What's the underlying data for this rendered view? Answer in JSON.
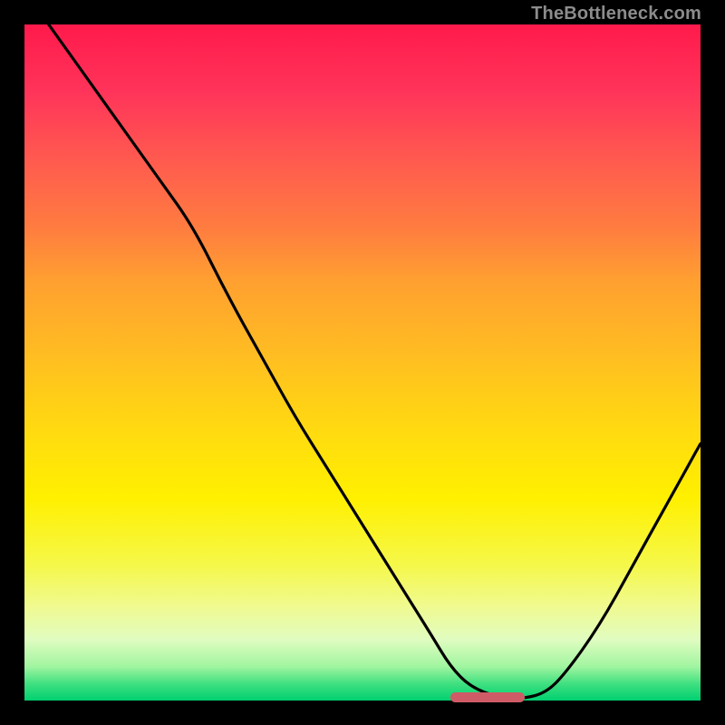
{
  "watermark": "TheBottleneck.com",
  "colors": {
    "background": "#000000",
    "marker": "#cf5b67",
    "curve": "#000000",
    "watermark_text": "#8c8c8c"
  },
  "chart_data": {
    "type": "line",
    "title": "",
    "xlabel": "",
    "ylabel": "",
    "xlim": [
      0,
      100
    ],
    "ylim": [
      0,
      100
    ],
    "x": [
      0,
      5,
      10,
      15,
      20,
      25,
      30,
      35,
      40,
      45,
      50,
      55,
      60,
      63,
      66,
      70,
      73,
      77,
      80,
      85,
      90,
      95,
      100
    ],
    "values": [
      105,
      98,
      91,
      84,
      77,
      70,
      60,
      51,
      42,
      34,
      26,
      18,
      10,
      5,
      2,
      0.5,
      0.2,
      1,
      4,
      11,
      20,
      29,
      38
    ],
    "optimum_range_x": [
      63,
      74
    ],
    "optimum_value_y": 0.5,
    "gradient_stops": [
      {
        "pos": 0,
        "color": "#ff1a4c"
      },
      {
        "pos": 0.1,
        "color": "#ff345a"
      },
      {
        "pos": 0.2,
        "color": "#ff5a4f"
      },
      {
        "pos": 0.3,
        "color": "#ff7c40"
      },
      {
        "pos": 0.38,
        "color": "#ffa030"
      },
      {
        "pos": 0.5,
        "color": "#ffc020"
      },
      {
        "pos": 0.6,
        "color": "#ffda10"
      },
      {
        "pos": 0.7,
        "color": "#fff000"
      },
      {
        "pos": 0.8,
        "color": "#f5f84a"
      },
      {
        "pos": 0.86,
        "color": "#f0fa8f"
      },
      {
        "pos": 0.91,
        "color": "#e0fcc0"
      },
      {
        "pos": 0.95,
        "color": "#a0f5a0"
      },
      {
        "pos": 0.975,
        "color": "#40e080"
      },
      {
        "pos": 1.0,
        "color": "#00d070"
      }
    ]
  }
}
